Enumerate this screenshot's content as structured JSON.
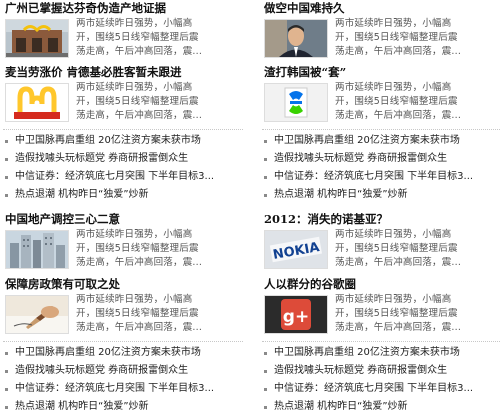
{
  "summary_lines": [
    "两市延续昨日强势，小幅高",
    "开，围绕5日线窄幅整理后震",
    "荡走高，午后冲高回落，震..."
  ],
  "left": {
    "block1": {
      "headline": "广州已掌握达芬奇伪造产地证据",
      "thumb": "mcdonalds-restaurant-photo"
    },
    "block2": {
      "headline": "麦当劳涨价 肯德基必胜客暂未跟进",
      "thumb": "mcdonalds-logo"
    },
    "list1": [
      "中卫国脉再启重组 20亿注资方案未获市场",
      "造假找噱头玩标题党 券商研报雷倒众生",
      "中信证券：经济筑底七月突围 下半年目标3...",
      "热点退潮 机构昨日“独爱”炒新"
    ],
    "block3": {
      "headline": "中国地产调控三心二意",
      "thumb": "city-buildings-photo"
    },
    "block4": {
      "headline": "保障房政策有可取之处",
      "thumb": "writing-hand-photo"
    },
    "list2": [
      "中卫国脉再启重组 20亿注资方案未获市场",
      "造假找噱头玩标题党 券商研报雷倒众生",
      "中信证券：经济筑底七月突围 下半年目标3...",
      "热点退潮 机构昨日“独爱”炒新"
    ]
  },
  "right": {
    "block1": {
      "headline": "做空中国难持久",
      "thumb": "businessman-portrait-photo"
    },
    "block2": {
      "headline": "渣打韩国被“套”",
      "thumb": "standard-chartered-logo"
    },
    "list1": [
      "中卫国脉再启重组 20亿注资方案未获市场",
      "造假找噱头玩标题党 券商研报雷倒众生",
      "中信证券：经济筑底七月突围 下半年目标3...",
      "热点退潮 机构昨日“独爱”炒新"
    ],
    "block3": {
      "headline": "2012：消失的诺基亚？",
      "thumb": "nokia-logo",
      "logo_text": "NOKIA"
    },
    "block4": {
      "headline": "人以群分的谷歌圈",
      "thumb": "google-plus-logo",
      "logo_text": "g+"
    },
    "list2": [
      "中卫国脉再启重组 20亿注资方案未获市场",
      "造假找噱头玩标题党 券商研报雷倒众生",
      "中信证券：经济筑底七月突围 下半年目标3...",
      "热点退潮 机构昨日“独爱”炒新"
    ]
  },
  "colors": {
    "mcdonalds_red": "#d52b1e",
    "mcdonalds_yellow": "#ffc72c",
    "nokia_blue": "#124191",
    "gplus_red": "#dd4b39",
    "bullet": "#8a8a8a"
  }
}
